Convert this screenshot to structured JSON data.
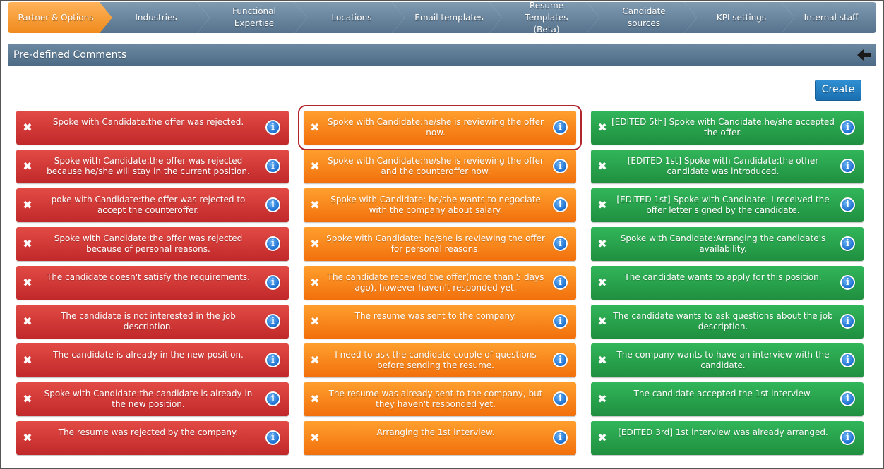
{
  "tabs": [
    {
      "label": "Partner & Options",
      "active": true
    },
    {
      "label": "Industries"
    },
    {
      "label": "Functional Expertise",
      "l1": "Functional",
      "l2": "Expertise"
    },
    {
      "label": "Locations"
    },
    {
      "label": "Email templates"
    },
    {
      "label": "Resume Templates (Beta)",
      "l1": "Resume Templates",
      "l2": "(Beta)"
    },
    {
      "label": "Candidate sources"
    },
    {
      "label": "KPI settings"
    },
    {
      "label": "Internal staff"
    }
  ],
  "panel": {
    "title": "Pre-defined Comments",
    "create_label": "Create",
    "columns": [
      {
        "color": "red",
        "items": [
          "Spoke with Candidate:the offer was rejected.",
          "Spoke with Candidate:the offer was rejected because he/she will stay in the current position.",
          "poke with Candidate:the offer was rejected to accept the counteroffer.",
          "Spoke with Candidate:the offer was rejected because of personal reasons.",
          "The candidate doesn't satisfy the requirements.",
          "The candidate is not interested in the job description.",
          "The candidate is already in the new position.",
          "Spoke with Candidate:the candidate is already in the new position.",
          "The resume was rejected by the company."
        ]
      },
      {
        "color": "orange",
        "items": [
          "Spoke with Candidate:he/she is reviewing the offer now.",
          "Spoke with Candidate:he/she is reviewing the offer and the counteroffer now.",
          "Spoke with Candidate: he/she wants to negociate with the company about salary.",
          "Spoke with Candidate: he/she is reviewing the offer for personal reasons.",
          "The candidate received the offer(more than 5 days ago), however haven't responded yet.",
          "The resume was sent to the company.",
          "I need to ask the candidate couple of questions before sending the resume.",
          "The resume was already sent to the company, but they haven't responded yet.",
          "Arranging the 1st interview."
        ]
      },
      {
        "color": "green",
        "items": [
          "[EDITED 5th] Spoke with Candidate:he/she accepted the offer.",
          "[EDITED 1st] Spoke with Candidate:the other candidate was introduced.",
          "[EDITED 1st] Spoke with Candidate: I received the offer letter signed by the candidate.",
          "Spoke with Candidate:Arranging the candidate's availability.",
          "The candidate wants to apply for this position.",
          "The candidate wants to ask questions about the job description.",
          "The company wants to have an interview with the candidate.",
          "The candidate accepted the 1st interview.",
          "[EDITED 3rd] 1st interview was already arranged."
        ]
      }
    ]
  },
  "icons": {
    "delete": "close-icon",
    "info": "info-icon",
    "back": "back-arrow-icon"
  },
  "colors": {
    "red": "#d03434",
    "orange": "#f7861c",
    "green": "#28a34a",
    "header": "#5a7894",
    "active_tab": "#f49a30"
  },
  "selected": {
    "column": 1,
    "item": 0
  }
}
